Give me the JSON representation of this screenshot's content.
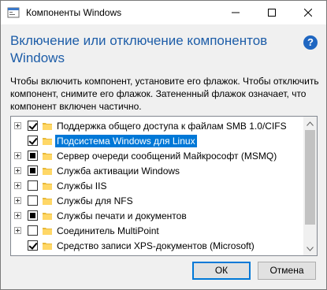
{
  "window": {
    "title": "Компоненты Windows"
  },
  "heading": "Включение или отключение компонентов Windows",
  "description": "Чтобы включить компонент, установите его флажок. Чтобы отключить компонент, снимите его флажок. Затененный флажок означает, что компонент включен частично.",
  "features": [
    {
      "label": "Поддержка общего доступа к файлам SMB 1.0/CIFS",
      "state": "checked",
      "expandable": true,
      "selected": false
    },
    {
      "label": "Подсистема Windows для Linux",
      "state": "checked",
      "expandable": false,
      "selected": true
    },
    {
      "label": "Сервер очереди сообщений Майкрософт (MSMQ)",
      "state": "partial",
      "expandable": true,
      "selected": false
    },
    {
      "label": "Служба активации Windows",
      "state": "partial",
      "expandable": true,
      "selected": false
    },
    {
      "label": "Службы IIS",
      "state": "unchecked",
      "expandable": true,
      "selected": false
    },
    {
      "label": "Службы для NFS",
      "state": "unchecked",
      "expandable": true,
      "selected": false
    },
    {
      "label": "Службы печати и документов",
      "state": "partial",
      "expandable": true,
      "selected": false
    },
    {
      "label": "Соединитель MultiPoint",
      "state": "unchecked",
      "expandable": true,
      "selected": false
    },
    {
      "label": "Средство записи XPS-документов (Microsoft)",
      "state": "checked",
      "expandable": false,
      "selected": false
    }
  ],
  "buttons": {
    "ok": "ОК",
    "cancel": "Отмена"
  },
  "colors": {
    "accent": "#0078d7",
    "heading": "#1d5da8",
    "folder": "#ffd766"
  }
}
